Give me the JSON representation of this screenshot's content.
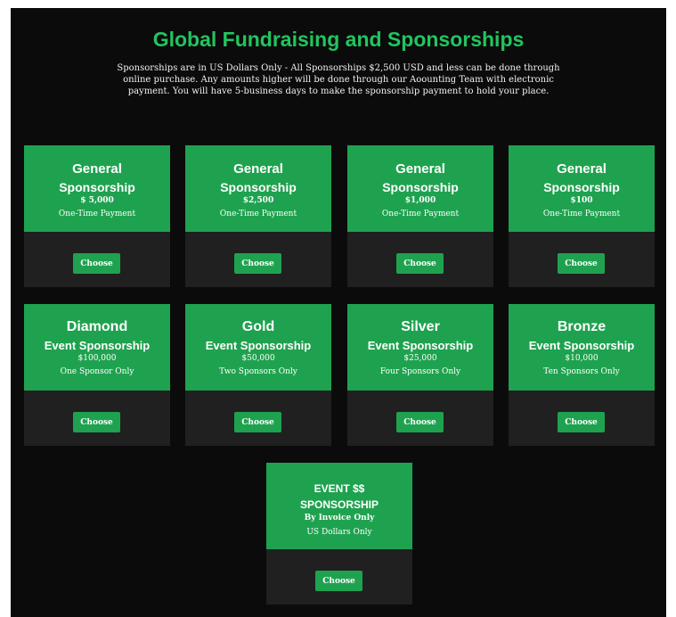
{
  "header": {
    "title": "Global Fundraising and Sponsorships",
    "intro": "Sponsorships are in US Dollars Only - All Sponsorships $2,500 USD and less can be done through online purchase. Any amounts higher will be done through our Aoounting Team with electronic payment. You will have 5-business days to make the sponsorship payment to hold your place."
  },
  "general": [
    {
      "name": "General",
      "sub": "Sponsorship",
      "price": "$ 5,000",
      "note": "One-Time Payment",
      "button": "Choose"
    },
    {
      "name": "General",
      "sub": "Sponsorship",
      "price": "$2,500",
      "note": "One-Time Payment",
      "button": "Choose"
    },
    {
      "name": "General",
      "sub": "Sponsorship",
      "price": "$1,000",
      "note": "One-Time Payment",
      "button": "Choose"
    },
    {
      "name": "General",
      "sub": "Sponsorship",
      "price": "$100",
      "note": "One-Time Payment",
      "button": "Choose"
    }
  ],
  "event": [
    {
      "name": "Diamond",
      "sub": "Event Sponsorship",
      "price": "$100,000",
      "note": "One Sponsor Only",
      "button": "Choose"
    },
    {
      "name": "Gold",
      "sub": "Event Sponsorship",
      "price": "$50,000",
      "note": "Two Sponsors Only",
      "button": "Choose"
    },
    {
      "name": "Silver",
      "sub": "Event Sponsorship",
      "price": "$25,000",
      "note": "Four Sponsors Only",
      "button": "Choose"
    },
    {
      "name": "Bronze",
      "sub": "Event Sponsorship",
      "price": "$10,000",
      "note": "Ten Sponsors Only",
      "button": "Choose"
    }
  ],
  "invoice": {
    "name": "EVENT $$",
    "sub": "SPONSORSHIP",
    "price": "By Invoice Only",
    "note": "US Dollars Only",
    "button": "Choose"
  },
  "colors": {
    "accent": "#22c55e",
    "card_green": "#1fa24f",
    "background": "#0b0b0b",
    "card_dark": "#202020"
  }
}
